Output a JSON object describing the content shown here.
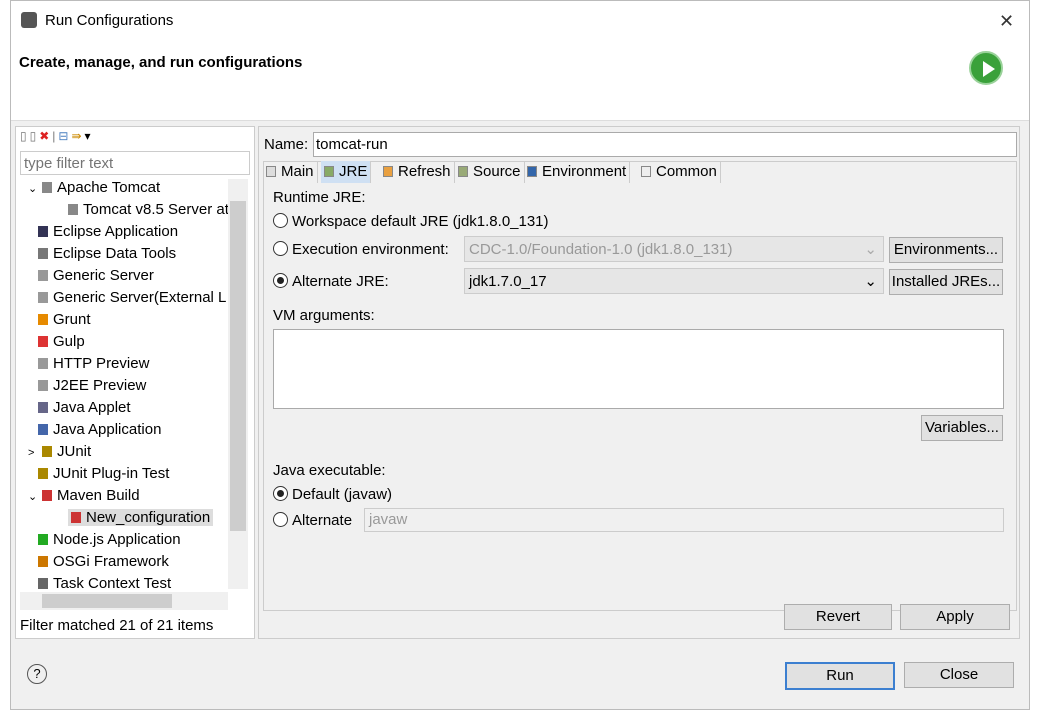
{
  "window": {
    "title": "Run Configurations",
    "close": "✕"
  },
  "header": {
    "title": "Create, manage, and run configurations"
  },
  "sidebar": {
    "filter_placeholder": "type filter text",
    "items": [
      {
        "label": "Apache Tomcat",
        "expand": "⌄"
      },
      {
        "label": "Tomcat v8.5 Server at"
      },
      {
        "label": "Eclipse Application"
      },
      {
        "label": "Eclipse Data Tools"
      },
      {
        "label": "Generic Server"
      },
      {
        "label": "Generic Server(External L"
      },
      {
        "label": "Grunt"
      },
      {
        "label": "Gulp"
      },
      {
        "label": "HTTP Preview"
      },
      {
        "label": "J2EE Preview"
      },
      {
        "label": "Java Applet"
      },
      {
        "label": "Java Application"
      },
      {
        "label": "JUnit",
        "expand": ">"
      },
      {
        "label": "JUnit Plug-in Test"
      },
      {
        "label": "Maven Build",
        "expand": "⌄"
      },
      {
        "label": "New_configuration"
      },
      {
        "label": "Node.js Application"
      },
      {
        "label": "OSGi Framework"
      },
      {
        "label": "Task Context Test"
      }
    ],
    "status": "Filter matched 21 of 21 items"
  },
  "main": {
    "name_label": "Name:",
    "name_value": "tomcat-run",
    "tabs": [
      "Main",
      "JRE",
      "Refresh",
      "Source",
      "Environment",
      "Common"
    ],
    "runtime_jre": "Runtime JRE:",
    "workspace_default": "Workspace default JRE (jdk1.8.0_131)",
    "execution_env": "Execution environment:",
    "execution_env_value": "CDC-1.0/Foundation-1.0 (jdk1.8.0_131)",
    "environments_btn": "Environments...",
    "alternate_jre": "Alternate JRE:",
    "alternate_jre_value": "jdk1.7.0_17",
    "installed_jres_btn": "Installed JREs...",
    "vm_arguments": "VM arguments:",
    "variables_btn": "Variables...",
    "java_executable": "Java executable:",
    "default_javaw": "Default (javaw)",
    "alternate": "Alternate",
    "alternate_value": "javaw",
    "revert": "Revert",
    "apply": "Apply"
  },
  "footer": {
    "help": "?",
    "run": "Run",
    "close": "Close"
  }
}
